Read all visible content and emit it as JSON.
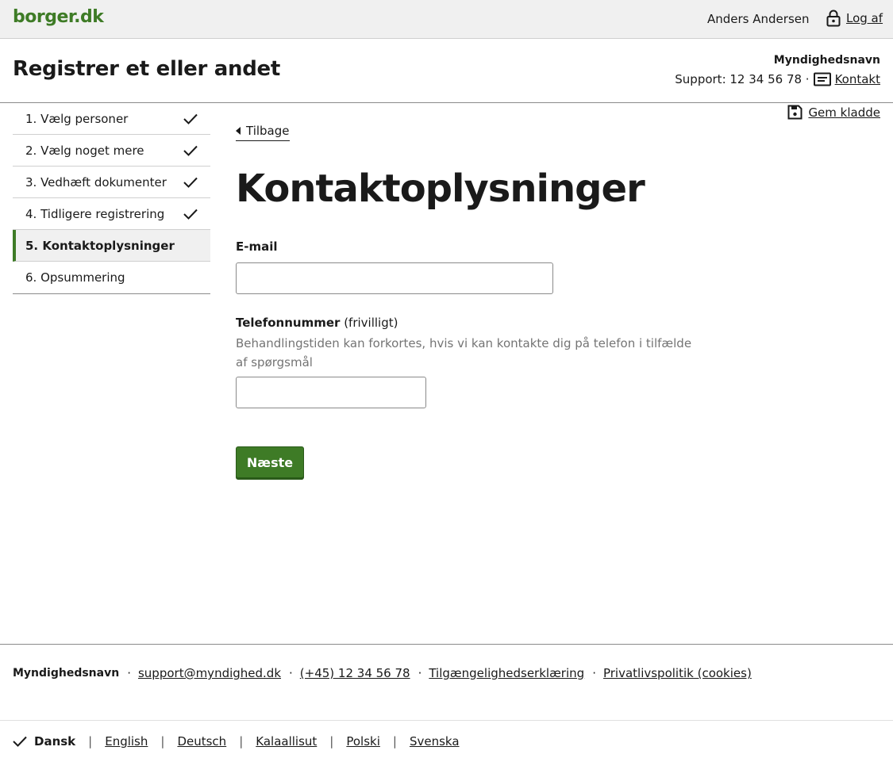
{
  "header": {
    "logo": "borger.dk",
    "user_name": "Anders Andersen",
    "logout_label": "Log af"
  },
  "subheader": {
    "title": "Registrer et eller andet",
    "authority": "Myndighedsnavn",
    "support_text": "Support: 12 34 56 78 ·",
    "contact_label": "Kontakt"
  },
  "steps": [
    {
      "label": "1. Vælg personer",
      "done": true
    },
    {
      "label": "2. Vælg noget mere",
      "done": true
    },
    {
      "label": "3. Vedhæft dokumenter",
      "done": true
    },
    {
      "label": "4. Tidligere registrering",
      "done": true
    },
    {
      "label": "5. Kontaktoplysninger",
      "current": true
    },
    {
      "label": "6. Opsummering"
    }
  ],
  "toolbar": {
    "save_draft_label": "Gem kladde",
    "back_label": "Tilbage"
  },
  "form": {
    "heading": "Kontaktoplysninger",
    "email_label": "E-mail",
    "email_value": "",
    "phone_label": "Telefonnummer",
    "phone_optional": " (frivilligt)",
    "phone_hint": "Behandlingstiden kan forkortes, hvis vi kan kontakte dig på telefon i tilfælde af spørgsmål",
    "phone_value": "",
    "next_label": "Næste"
  },
  "footer": {
    "authority": "Myndighedsnavn",
    "email": "support@myndighed.dk",
    "phone": "(+45) 12 34 56 78",
    "accessibility": "Tilgængelighedserklæring",
    "privacy": "Privatlivspolitik (cookies)"
  },
  "languages": {
    "current": "Dansk",
    "others": [
      "English",
      "Deutsch",
      "Kalaallisut",
      "Polski",
      "Svenska"
    ]
  },
  "colors": {
    "brand": "#3e7b26",
    "top_bar": "#f0f0f0",
    "hint_text": "#747474"
  }
}
